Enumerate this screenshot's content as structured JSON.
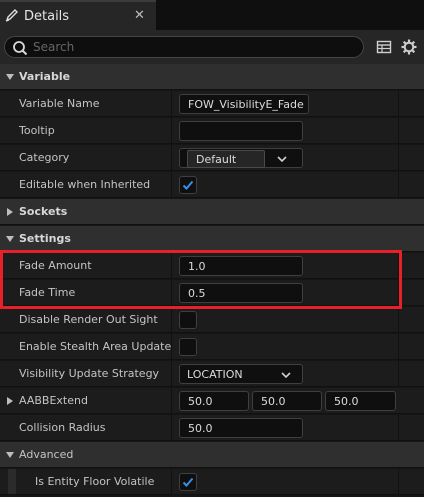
{
  "window": {
    "tab_title": "Details",
    "close_glyph": "✕"
  },
  "search": {
    "placeholder": "Search"
  },
  "toolbar": {
    "icons": [
      "table-view-icon",
      "settings-gear-icon"
    ]
  },
  "colors": {
    "highlight": "#e8202a",
    "checkbox_checkmark": "#3a8ee6"
  },
  "categories": {
    "variable": "Variable",
    "sockets": "Sockets",
    "settings": "Settings",
    "advanced": "Advanced"
  },
  "properties": {
    "variable_name": {
      "label": "Variable Name",
      "value": "FOW_VisibilityE_Fade"
    },
    "tooltip": {
      "label": "Tooltip",
      "value": ""
    },
    "category": {
      "label": "Category",
      "value": "Default"
    },
    "editable_when_inherited": {
      "label": "Editable when Inherited",
      "checked": true
    },
    "fade_amount": {
      "label": "Fade Amount",
      "value": "1.0"
    },
    "fade_time": {
      "label": "Fade Time",
      "value": "0.5"
    },
    "disable_render_out_sight": {
      "label": "Disable Render Out Sight",
      "checked": false
    },
    "enable_stealth_area_update": {
      "label": "Enable Stealth Area Update",
      "checked": false
    },
    "visibility_update_strategy": {
      "label": "Visibility Update Strategy",
      "value": "LOCATION"
    },
    "aabb_extend": {
      "label": "AABBExtend",
      "x": "50.0",
      "y": "50.0",
      "z": "50.0"
    },
    "collision_radius": {
      "label": "Collision Radius",
      "value": "50.0"
    },
    "is_entity_floor_volatile": {
      "label": "Is Entity Floor Volatile",
      "checked": true
    }
  }
}
